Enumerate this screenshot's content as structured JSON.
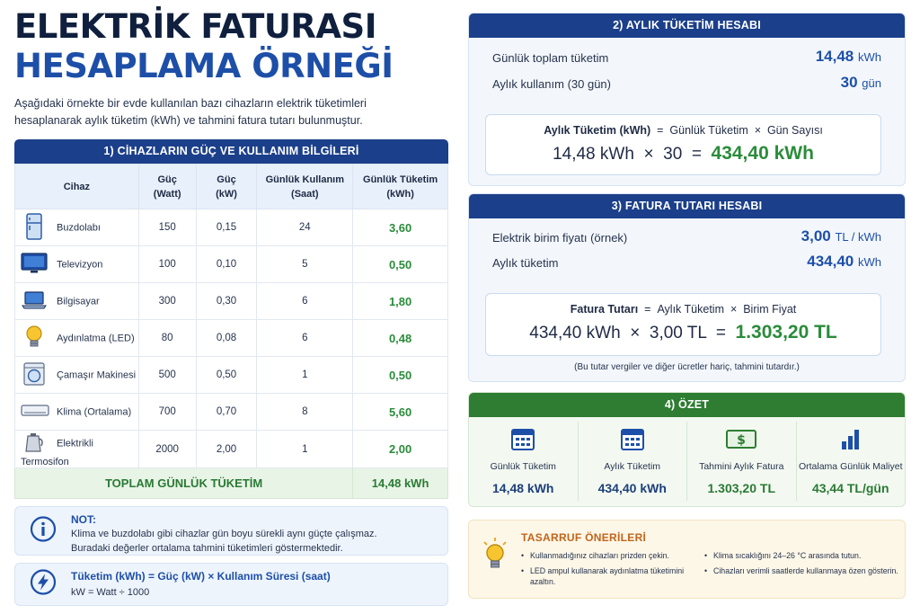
{
  "title": {
    "line1": "ELEKTRİK FATURASI",
    "line2": "HESAPLAMA ÖRNEĞİ"
  },
  "intro": "Aşağıdaki örnekte bir evde kullanılan bazı cihazların elektrik tüketimleri hesaplanarak aylık tüketim (kWh) ve tahmini fatura tutarı bulunmuştur.",
  "section1": {
    "title": "1) CİHAZLARIN GÜÇ VE KULLANIM BİLGİLERİ",
    "headers": {
      "device": "Cihaz",
      "power_w_1": "Güç",
      "power_w_2": "(Watt)",
      "power_kw_1": "Güç",
      "power_kw_2": "(kW)",
      "usage_1": "Günlük Kullanım",
      "usage_2": "(Saat)",
      "cons_1": "Günlük Tüketim",
      "cons_2": "(kWh)"
    },
    "rows": [
      {
        "icon": "fridge-icon",
        "name": "Buzdolabı",
        "watt": "150",
        "kw": "0,15",
        "hours": "24",
        "kwh": "3,60"
      },
      {
        "icon": "tv-icon",
        "name": "Televizyon",
        "watt": "100",
        "kw": "0,10",
        "hours": "5",
        "kwh": "0,50"
      },
      {
        "icon": "laptop-icon",
        "name": "Bilgisayar",
        "watt": "300",
        "kw": "0,30",
        "hours": "6",
        "kwh": "1,80"
      },
      {
        "icon": "lightbulb-icon",
        "name": "Aydınlatma (LED)",
        "watt": "80",
        "kw": "0,08",
        "hours": "6",
        "kwh": "0,48"
      },
      {
        "icon": "washing-machine-icon",
        "name": "Çamaşır Makinesi",
        "watt": "500",
        "kw": "0,50",
        "hours": "1",
        "kwh": "0,50"
      },
      {
        "icon": "air-conditioner-icon",
        "name": "Klima (Ortalama)",
        "watt": "700",
        "kw": "0,70",
        "hours": "8",
        "kwh": "5,60"
      },
      {
        "icon": "kettle-icon",
        "name": "Elektrikli Termosifon",
        "watt": "2000",
        "kw": "2,00",
        "hours": "1",
        "kwh": "2,00"
      }
    ],
    "total_label": "TOPLAM GÜNLÜK TÜKETİM",
    "total_value": "14,48 kWh"
  },
  "note": {
    "title": "NOT:",
    "line1": "Klima ve buzdolabı gibi cihazlar gün boyu sürekli aynı güçte çalışmaz.",
    "line2": "Buradaki değerler ortalama tahmini tüketimleri göstermektedir."
  },
  "formula_note": {
    "title": "Tüketim (kWh) = Güç (kW) × Kullanım Süresi (saat)",
    "line": "kW = Watt ÷ 1000"
  },
  "section2": {
    "title": "2) AYLIK TÜKETİM HESABI",
    "row1_label": "Günlük toplam tüketim",
    "row1_value": "14,48",
    "row1_unit": "kWh",
    "row2_label": "Aylık kullanım (30 gün)",
    "row2_value": "30",
    "row2_unit": "gün",
    "formula_a": "Aylık Tüketim (kWh)",
    "formula_eq": "=",
    "formula_b": "Günlük Tüketim",
    "formula_x": "×",
    "formula_c": "Gün Sayısı",
    "calc_a": "14,48 kWh",
    "calc_x": "×",
    "calc_b": "30",
    "calc_eq": "=",
    "calc_result": "434,40 kWh"
  },
  "section3": {
    "title": "3) FATURA TUTARI HESABI",
    "row1_label": "Elektrik birim fiyatı (örnek)",
    "row1_value": "3,00",
    "row1_unit": "TL / kWh",
    "row2_label": "Aylık tüketim",
    "row2_value": "434,40",
    "row2_unit": "kWh",
    "formula_a": "Fatura Tutarı",
    "formula_eq": "=",
    "formula_b": "Aylık Tüketim",
    "formula_x": "×",
    "formula_c": "Birim Fiyat",
    "calc_a": "434,40 kWh",
    "calc_x": "×",
    "calc_b": "3,00 TL",
    "calc_eq": "=",
    "calc_result": "1.303,20 TL",
    "footnote": "(Bu tutar vergiler ve diğer ücretler hariç, tahmini tutardır.)"
  },
  "section4": {
    "title": "4) ÖZET",
    "items": [
      {
        "icon": "calendar-icon",
        "label": "Günlük Tüketim",
        "value": "14,48 kWh"
      },
      {
        "icon": "calendar-icon",
        "label": "Aylık Tüketim",
        "value": "434,40 kWh"
      },
      {
        "icon": "money-icon",
        "label": "Tahmini Aylık Fatura",
        "value": "1.303,20 TL"
      },
      {
        "icon": "bar-chart-icon",
        "label": "Ortalama Günlük Maliyet",
        "value": "43,44 TL/gün"
      }
    ]
  },
  "tips": {
    "title": "TASARRUF ÖNERİLERİ",
    "col1": [
      "Kullanmadığınız cihazları prizden çekin.",
      "LED ampul kullanarak aydınlatma tüketimini azaltın."
    ],
    "col2": [
      "Klima sıcaklığını 24–26 °C arasında tutun.",
      "Cihazları verimli saatlerde kullanmaya özen gösterin."
    ]
  },
  "colors": {
    "navy": "#1b3f8a",
    "blue": "#1d4fa8",
    "green": "#2a8c3a",
    "summary_green": "#2e7d32",
    "orange": "#c2641a"
  }
}
